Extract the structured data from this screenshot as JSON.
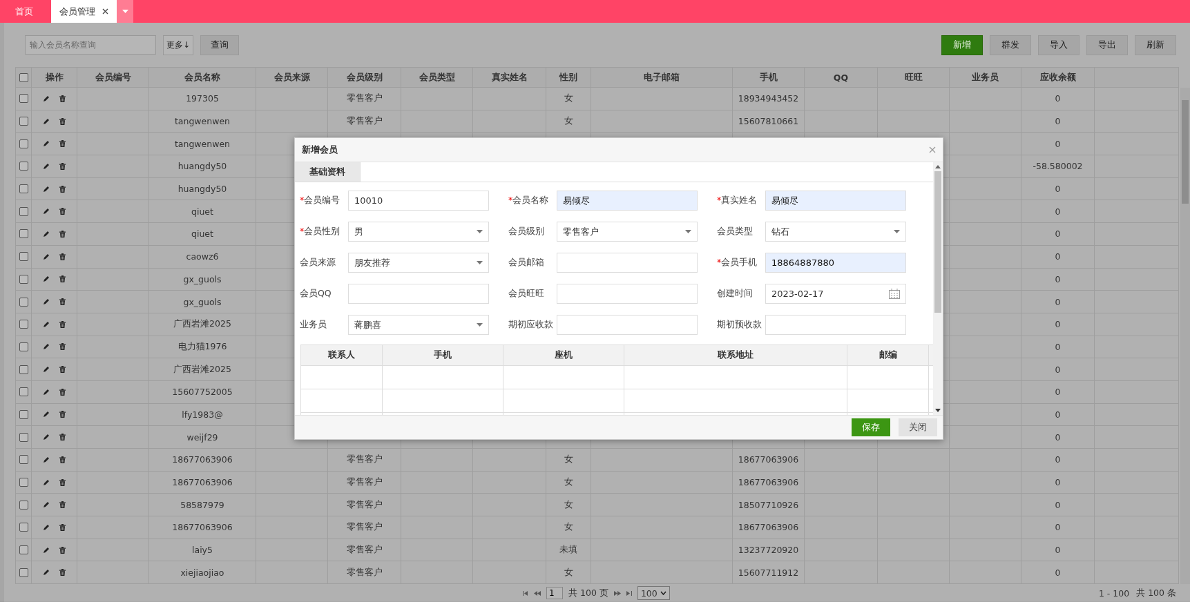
{
  "tabs": [
    {
      "label": "首页",
      "selected": false,
      "closable": false
    },
    {
      "label": "会员管理",
      "selected": true,
      "closable": true
    }
  ],
  "toolbar": {
    "search": {
      "placeholder": "输入会员名称查询"
    },
    "more_button": "更多↓",
    "query_button": "查询",
    "actions": [
      {
        "label": "新增",
        "primary": true
      },
      {
        "label": "群发",
        "primary": false
      },
      {
        "label": "导入",
        "primary": false
      },
      {
        "label": "导出",
        "primary": false
      },
      {
        "label": "刷新",
        "primary": false
      }
    ]
  },
  "table": {
    "select_all": {
      "checked": false
    },
    "columns": [
      "操作",
      "会员编号",
      "会员名称",
      "会员来源",
      "会员级别",
      "会员类型",
      "真实姓名",
      "性别",
      "电子邮箱",
      "手机",
      "QQ",
      "旺旺",
      "业务员",
      "应收余额"
    ],
    "rows": [
      {
        "checked": false,
        "name": "197305",
        "level": "零售客户",
        "gender": "女",
        "phone": "18934943452",
        "balance": "0"
      },
      {
        "checked": false,
        "name": "tangwenwen",
        "level": "零售客户",
        "gender": "女",
        "phone": "15607810661",
        "balance": "0"
      },
      {
        "checked": false,
        "name": "tangwenwen",
        "balance": "0"
      },
      {
        "checked": false,
        "name": "huangdy50",
        "balance": "-58.580002"
      },
      {
        "checked": false,
        "name": "huangdy50",
        "balance": "0"
      },
      {
        "checked": false,
        "name": "qiuet",
        "balance": "0"
      },
      {
        "checked": false,
        "name": "qiuet",
        "balance": "0"
      },
      {
        "checked": false,
        "name": "caowz6",
        "balance": "0"
      },
      {
        "checked": false,
        "name": "gx_guols",
        "balance": "0"
      },
      {
        "checked": false,
        "name": "gx_guols",
        "balance": "0"
      },
      {
        "checked": false,
        "name": "广西岩滩2025",
        "balance": "0"
      },
      {
        "checked": false,
        "name": "电力猫1976",
        "balance": "0"
      },
      {
        "checked": false,
        "name": "广西岩滩2025",
        "balance": "0"
      },
      {
        "checked": false,
        "name": "15607752005",
        "balance": "0"
      },
      {
        "checked": false,
        "name": "lfy1983@",
        "balance": "0"
      },
      {
        "checked": false,
        "name": "weijf29",
        "balance": "0"
      },
      {
        "checked": false,
        "name": "18677063906",
        "level": "零售客户",
        "gender": "女",
        "phone": "18677063906",
        "balance": "0"
      },
      {
        "checked": false,
        "name": "18677063906",
        "level": "零售客户",
        "gender": "女",
        "phone": "18677063906",
        "balance": "0"
      },
      {
        "checked": false,
        "name": "58587979",
        "level": "零售客户",
        "gender": "女",
        "phone": "18507710926",
        "balance": "0"
      },
      {
        "checked": false,
        "name": "18677063906",
        "level": "零售客户",
        "gender": "女",
        "phone": "18677063906",
        "balance": "0"
      },
      {
        "checked": false,
        "name": "laiy5",
        "level": "零售客户",
        "gender": "未填",
        "phone": "13237720920",
        "balance": "0"
      },
      {
        "checked": false,
        "name": "xiejiaojiao",
        "level": "零售客户",
        "gender": "女",
        "phone": "15607711912",
        "balance": "0"
      }
    ]
  },
  "pager": {
    "page": "1",
    "total_pages": "共 100 页",
    "page_size": "100",
    "range": "1 - 100",
    "total": "共 100 条"
  },
  "modal": {
    "title": "新增会员",
    "tabs": [
      {
        "label": "基础资料",
        "selected": true
      }
    ],
    "fields": [
      {
        "label": "会员编号",
        "required_mark": "*",
        "kind": "text",
        "value": "10010",
        "autofilled": false
      },
      {
        "label": "会员名称",
        "required_mark": "*",
        "kind": "text",
        "value": "易倾尽",
        "autofilled": true
      },
      {
        "label": "真实姓名",
        "required_mark": "*",
        "kind": "text",
        "value": "易倾尽",
        "autofilled": true
      },
      {
        "label": "会员性别",
        "required_mark": "*",
        "kind": "select",
        "value": "男",
        "autofilled": false
      },
      {
        "label": "会员级别",
        "kind": "select",
        "value": "零售客户",
        "autofilled": false
      },
      {
        "label": "会员类型",
        "kind": "select",
        "value": "钻石",
        "autofilled": false
      },
      {
        "label": "会员来源",
        "kind": "select",
        "value": "朋友推荐",
        "autofilled": false
      },
      {
        "label": "会员邮箱",
        "kind": "text",
        "autofilled": false
      },
      {
        "label": "会员手机",
        "required_mark": "*",
        "kind": "text",
        "value": "18864887880",
        "autofilled": true
      },
      {
        "label": "会员QQ",
        "kind": "text",
        "autofilled": false
      },
      {
        "label": "会员旺旺",
        "kind": "text",
        "autofilled": false
      },
      {
        "label": "创建时间",
        "kind": "date",
        "value": "2023-02-17",
        "autofilled": false
      },
      {
        "label": "业务员",
        "kind": "select",
        "value": "蒋鹏喜",
        "autofilled": false
      },
      {
        "label": "期初应收款",
        "kind": "text",
        "autofilled": false
      },
      {
        "label": "期初预收款",
        "kind": "text",
        "autofilled": false
      }
    ],
    "contacts": {
      "columns": [
        "联系人",
        "手机",
        "座机",
        "联系地址",
        "邮编"
      ]
    },
    "buttons": [
      {
        "label": "保存",
        "primary": true
      },
      {
        "label": "关闭",
        "primary": false
      }
    ]
  }
}
